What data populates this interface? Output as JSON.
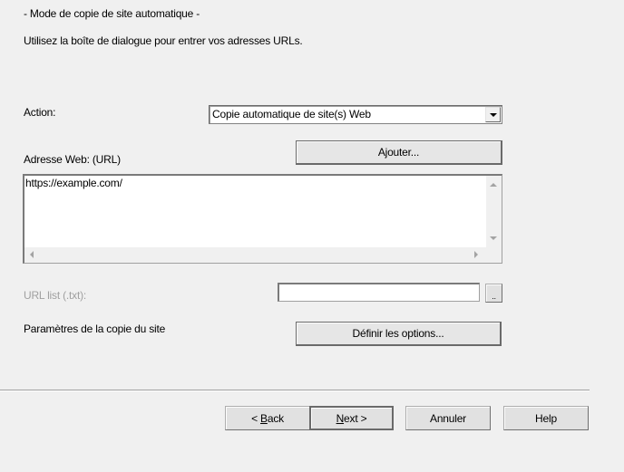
{
  "header": {
    "title": "- Mode de copie de site automatique -",
    "subtitle": "Utilisez la boîte de dialogue pour entrer vos adresses URLs."
  },
  "action": {
    "label": "Action:",
    "selected": "Copie automatique de site(s) Web",
    "dropdown_icon": "chevron-down-icon"
  },
  "web_address": {
    "label": "Adresse Web: (URL)",
    "add_button": "Ajouter...",
    "urls": "https://example.com/",
    "scroll_icons": [
      "scroll-up-icon",
      "scroll-down-icon",
      "scroll-left-icon",
      "scroll-right-icon"
    ]
  },
  "url_list": {
    "label": "URL list (.txt):",
    "value": "",
    "browse_button": ".."
  },
  "options": {
    "label": "Paramètres de la copie du site",
    "button": "Définir les options..."
  },
  "footer": {
    "back": {
      "prefix": "< ",
      "mnemonic": "B",
      "rest": "ack"
    },
    "next": {
      "mnemonic": "N",
      "rest": "ext >"
    },
    "cancel": "Annuler",
    "help": "Help"
  }
}
